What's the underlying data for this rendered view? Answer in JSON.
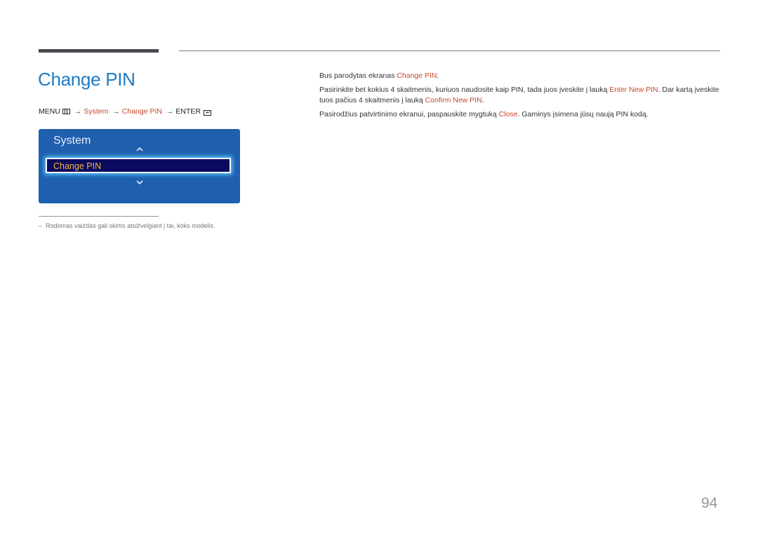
{
  "page": {
    "title": "Change PIN",
    "page_number": "94"
  },
  "menu_path": {
    "menu": "MENU",
    "menu_icon": "menu-grid-icon",
    "arrow": "→",
    "step1": "System",
    "step2": "Change PIN",
    "enter": "ENTER",
    "enter_icon": "enter-icon"
  },
  "osd": {
    "title": "System",
    "selected_item": "Change PIN",
    "up_icon": "chevron-up-icon",
    "down_icon": "chevron-down-icon"
  },
  "footnote": {
    "dash": "–",
    "text": "Rodomas vaizdas gali skirtis atsižvelgiant į tai, koks modelis."
  },
  "body": {
    "p1_a": "Bus parodytas ekranas ",
    "p1_hl": "Change PIN",
    "p1_b": ".",
    "p2_a": "Pasirinkite bet kokius 4 skaitmenis, kuriuos naudosite kaip PIN, tada juos įveskite į lauką ",
    "p2_hl1": "Enter New PIN",
    "p2_b": ". Dar kartą įveskite tuos pačius 4 skaitmenis į lauką ",
    "p2_hl2": "Confirm New PIN",
    "p2_c": ".",
    "p3_a": "Pasirodžius patvirtinimo ekranui, paspauskite mygtuką ",
    "p3_hl": "Close",
    "p3_b": ". Gaminys įsimena jūsų naują PIN kodą."
  },
  "colors": {
    "title_blue": "#1e7bc3",
    "highlight_red": "#c8472a",
    "osd_blue": "#1f5fae",
    "osd_selected_bg": "#0a0a5e",
    "osd_selected_text": "#f5b93a"
  }
}
